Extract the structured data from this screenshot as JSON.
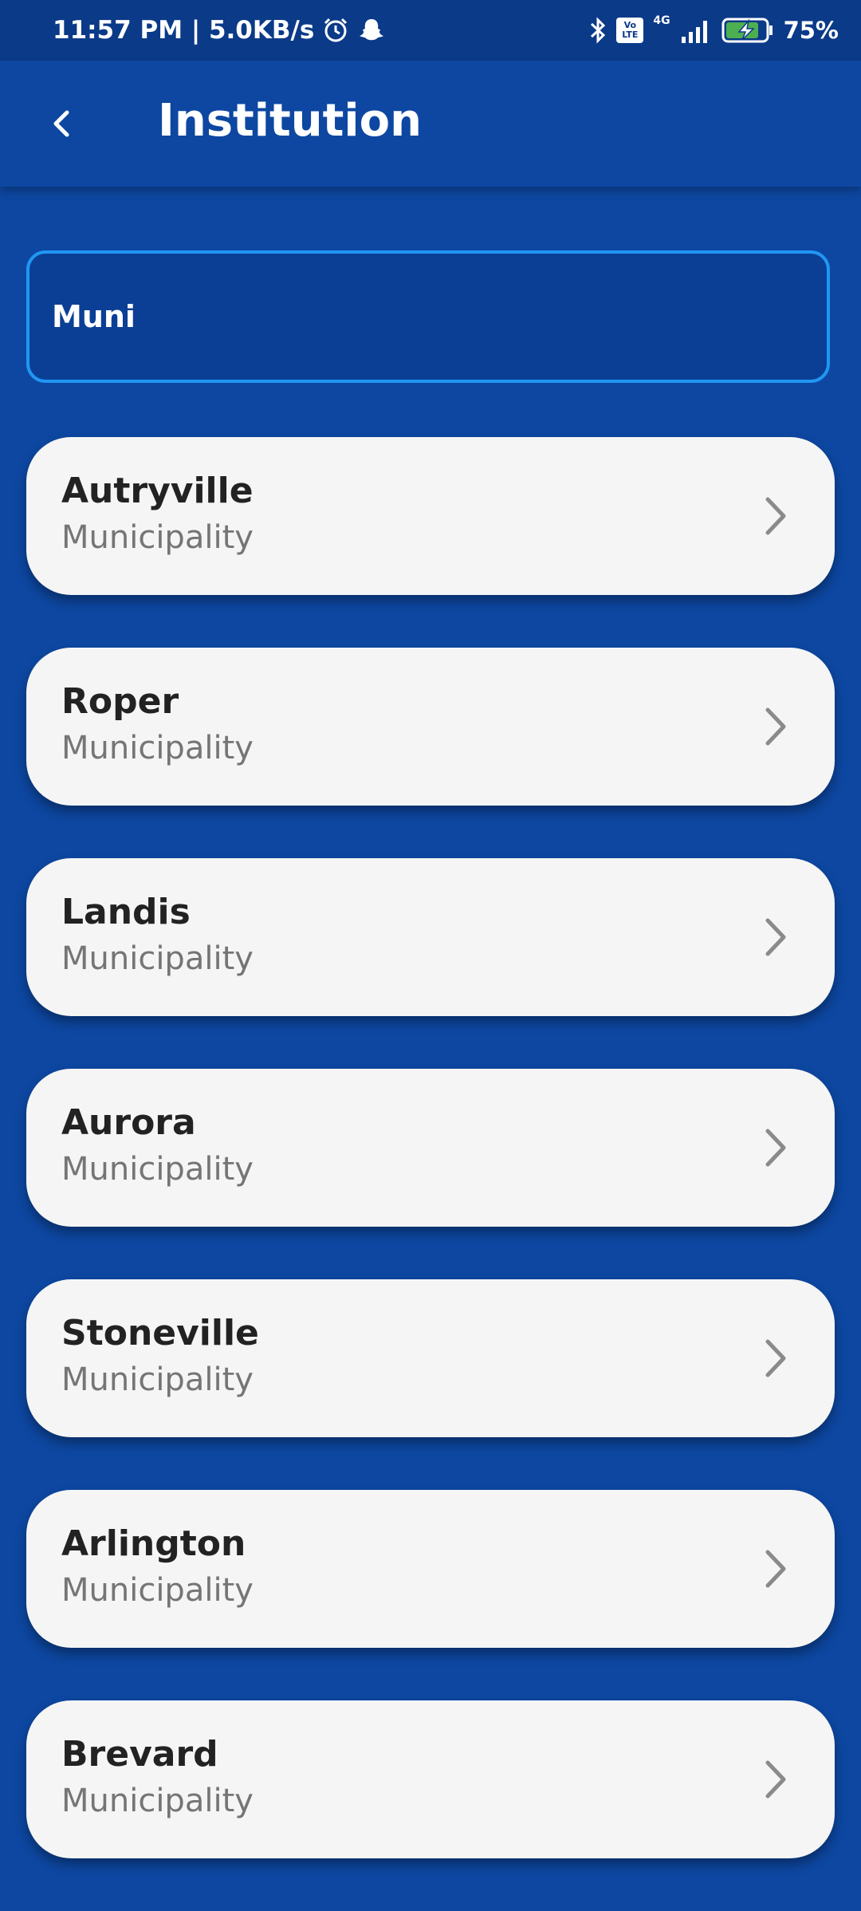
{
  "status_bar": {
    "time_speed": "11:57 PM | 5.0KB/s",
    "network": "4G",
    "volte": "Vo LTE",
    "battery": "75%",
    "icons": [
      "alarm-icon",
      "snapchat-icon",
      "bluetooth-icon",
      "volte-icon",
      "signal-icon",
      "battery-charging-icon"
    ]
  },
  "header": {
    "title": "Institution",
    "back_icon": "chevron-left-icon"
  },
  "search": {
    "value": "Muni",
    "accent_color": "#2196f3"
  },
  "results": [
    {
      "name": "Autryville",
      "type": "Municipality"
    },
    {
      "name": "Roper",
      "type": "Municipality"
    },
    {
      "name": "Landis",
      "type": "Municipality"
    },
    {
      "name": "Aurora",
      "type": "Municipality"
    },
    {
      "name": "Stoneville",
      "type": "Municipality"
    },
    {
      "name": "Arlington",
      "type": "Municipality"
    },
    {
      "name": "Brevard",
      "type": "Municipality"
    }
  ],
  "colors": {
    "background": "#0d47a1",
    "card": "#f5f5f5",
    "title_text": "#222222",
    "subtitle_text": "#757575"
  }
}
